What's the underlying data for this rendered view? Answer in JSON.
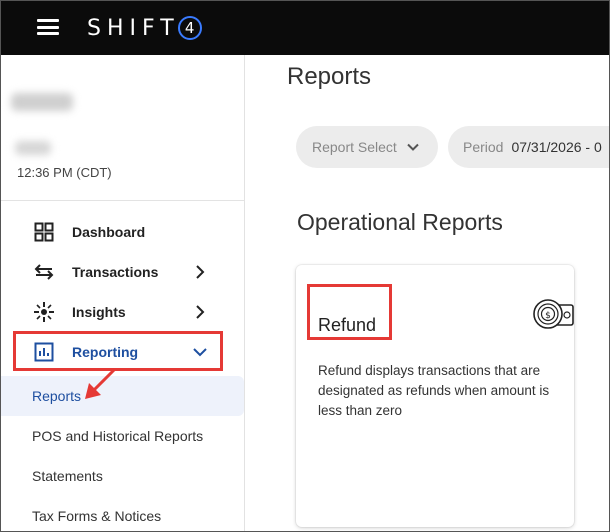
{
  "topbar": {
    "brand_text": "SHIFT",
    "brand_badge": "4",
    "brand_color": "#3a7bff"
  },
  "sidebar": {
    "time": "12:36 PM (CDT)",
    "items": [
      {
        "label": "Dashboard",
        "icon": "grid-icon"
      },
      {
        "label": "Transactions",
        "icon": "swap-arrows-icon"
      },
      {
        "label": "Insights",
        "icon": "sparkle-icon"
      },
      {
        "label": "Reporting",
        "icon": "bar-chart-icon"
      }
    ],
    "subitems": [
      {
        "label": "Reports",
        "active": true
      },
      {
        "label": "POS and Historical Reports"
      },
      {
        "label": "Statements"
      },
      {
        "label": "Tax Forms & Notices"
      }
    ],
    "active_color": "#1e4fa0"
  },
  "main": {
    "title": "Reports",
    "filters": {
      "report_select_label": "Report Select",
      "period_label": "Period",
      "period_value": "07/31/2026 - 0"
    },
    "section_title": "Operational Reports",
    "card": {
      "title": "Refund",
      "description": "Refund displays transactions that are designated as refunds when amount is less than zero",
      "icon": "cash-coin-icon"
    }
  },
  "annotations": {
    "highlight_color": "#e53935"
  }
}
